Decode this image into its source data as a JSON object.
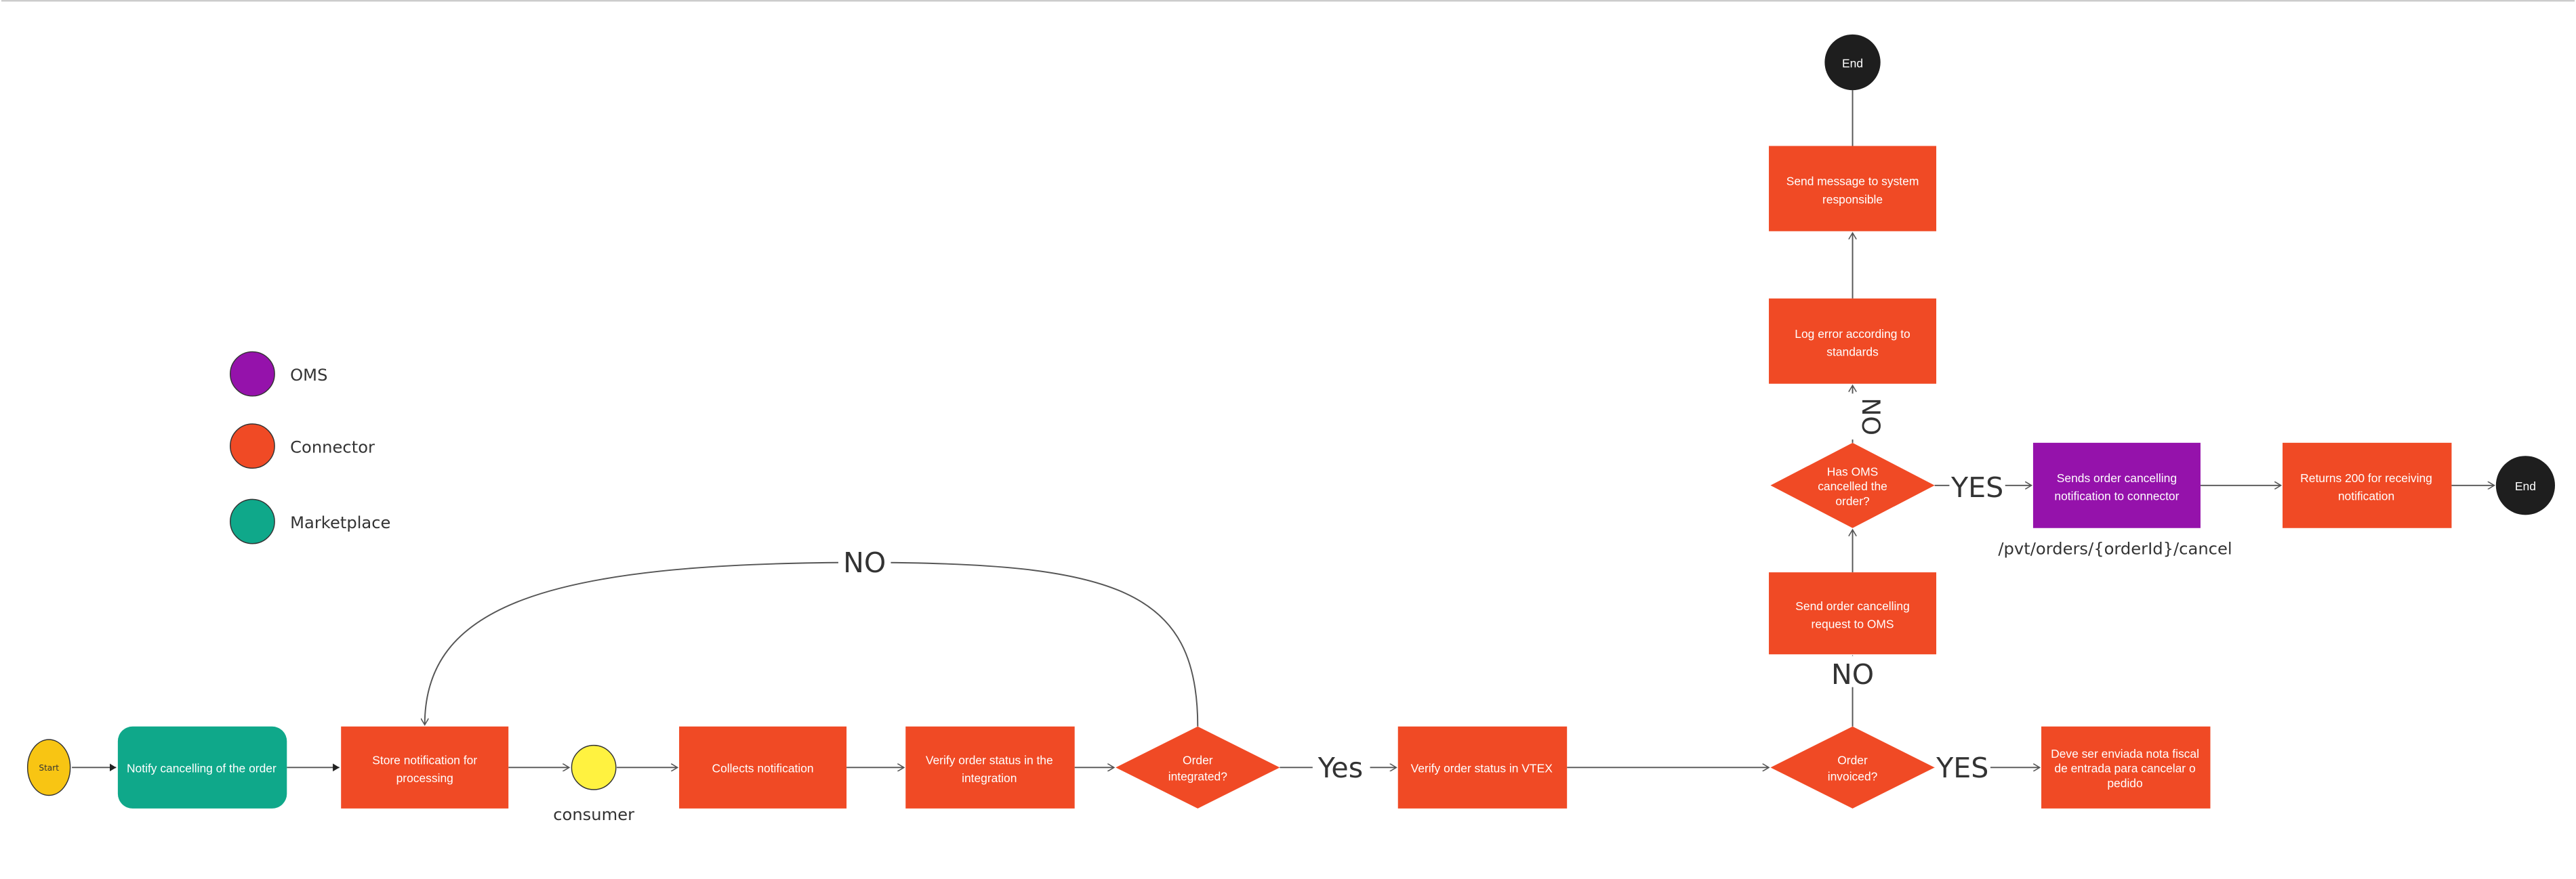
{
  "colors": {
    "oms": "#9512AB",
    "connector": "#F04A25",
    "marketplace": "#0FA88A",
    "start": "#F8C513",
    "consumer": "#FFF240",
    "end": "#1E1E1E"
  },
  "legend": [
    {
      "label": "OMS"
    },
    {
      "label": "Connector"
    },
    {
      "label": "Marketplace"
    }
  ],
  "nodes": {
    "start": "Start",
    "notify": "Notify cancelling of the order",
    "store": [
      "Store notification for",
      "processing"
    ],
    "consumer": "consumer",
    "collects": "Collects notification",
    "verify_integration": [
      "Verify order status in the",
      "integration"
    ],
    "order_integrated": [
      "Order",
      "integrated?"
    ],
    "verify_vtex": "Verify order status in VTEX",
    "order_invoiced": [
      "Order",
      "invoiced?"
    ],
    "nota_fiscal": [
      "Deve ser enviada nota fiscal",
      "de entrada para cancelar o",
      "pedido"
    ],
    "send_request": [
      "Send order cancelling",
      "request to OMS"
    ],
    "has_oms": [
      "Has OMS",
      "cancelled the",
      "order?"
    ],
    "sends_notification": [
      "Sends order cancelling",
      "notification to connector"
    ],
    "endpoint": "/pvt/orders/{orderId}/cancel",
    "returns_200": [
      "Returns 200 for receiving",
      "notification"
    ],
    "end_right": "End",
    "log_error": [
      "Log error according to",
      "standards"
    ],
    "send_message": [
      "Send message to system",
      "responsible"
    ],
    "end_top": "End"
  },
  "edges": {
    "no_loop": "NO",
    "yes_integrated": "Yes",
    "yes_invoiced": "YES",
    "no_invoiced": "NO",
    "yes_oms": "YES",
    "no_oms": "NO"
  }
}
